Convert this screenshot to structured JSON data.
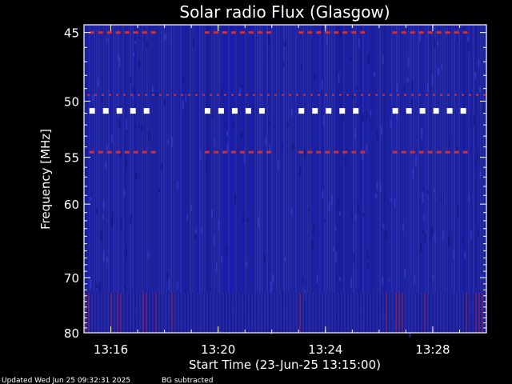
{
  "chart_data": {
    "type": "heatmap",
    "title": "Solar radio Flux (Glasgow)",
    "xlabel": "Start Time (23-Jun-25 13:15:00)",
    "ylabel": "Frequency [MHz]",
    "x_ticks": [
      {
        "minutes": 1,
        "label": "13:16"
      },
      {
        "minutes": 5,
        "label": "13:20"
      },
      {
        "minutes": 9,
        "label": "13:24"
      },
      {
        "minutes": 13,
        "label": "13:28"
      }
    ],
    "y_ticks": [
      45,
      50,
      55,
      60,
      70,
      80
    ],
    "xlim_minutes": [
      0,
      15
    ],
    "ylim_mhz": [
      80,
      44.5
    ],
    "y_scale": "reciprocal",
    "background_color": "#1b1f9e",
    "persistent_bands": [
      {
        "freq_mhz": 45,
        "color": "#d23030",
        "periodic": true
      },
      {
        "freq_mhz": 49.5,
        "color": "#d23030",
        "periodic": false
      },
      {
        "freq_mhz": 50.8,
        "color": "#ffffff",
        "periodic": true
      },
      {
        "freq_mhz": 54.5,
        "color": "#d23030",
        "periodic": true
      }
    ],
    "burst_groups_minutes": [
      [
        0.2,
        2.6
      ],
      [
        4.5,
        6.9
      ],
      [
        8.0,
        10.3
      ],
      [
        11.5,
        14.2
      ]
    ],
    "noise_band_mhz": [
      72.5,
      80
    ]
  },
  "footer": {
    "updated": "Updated Wed Jun 25 09:32:31 2025",
    "note": "BG subtracted"
  }
}
